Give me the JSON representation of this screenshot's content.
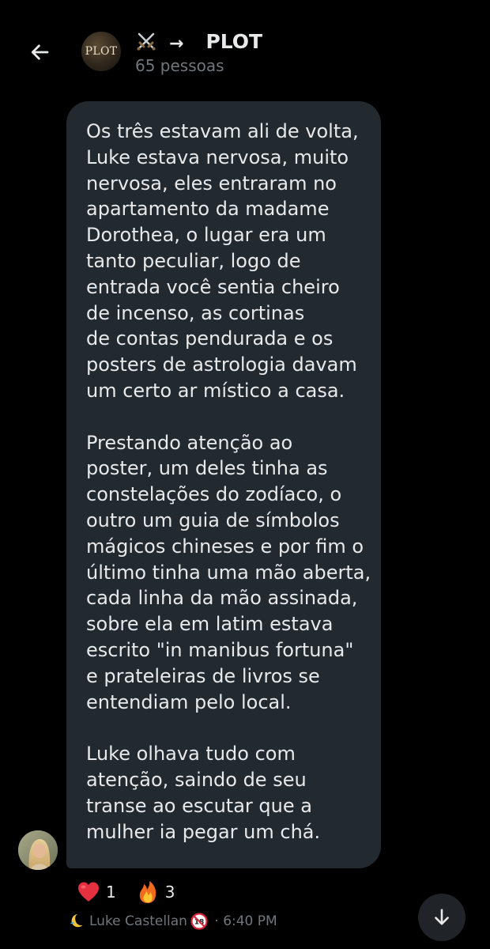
{
  "header": {
    "back_icon": "arrow-left-icon",
    "avatar_text": "PLOT",
    "title_emoji": "crossed-swords-icon",
    "title_arrow": "→",
    "title_text": "PLOT",
    "subtitle": "65 pessoas"
  },
  "message": {
    "paragraphs": [
      {
        "lines": [
          "Os três estavam ali de volta,",
          "Luke estava nervosa, muito",
          "nervosa, eles entraram no",
          "apartamento da madame",
          "Dorothea, o lugar era um",
          "tanto peculiar, logo de",
          "entrada você sentia cheiro",
          "de incenso, as cortinas",
          "de contas pendurada e os",
          "posters de astrologia davam",
          "um certo ar místico a casa."
        ]
      },
      {
        "lines": [
          "Prestando atenção ao",
          "poster, um deles tinha as",
          "constelações do zodíaco, o",
          "outro um guia de símbolos",
          "mágicos chineses e por fim o",
          "último tinha uma mão aberta,",
          "cada linha da mão assinada,",
          "sobre ela em latim estava",
          "escrito \"in manibus fortuna\"",
          "e prateleiras de livros se",
          "entendiam pelo local."
        ]
      },
      {
        "lines": [
          "Luke olhava tudo com",
          "atenção, saindo de seu",
          "transe ao escutar que a",
          "mulher ia pegar um chá."
        ]
      }
    ],
    "bubble_color": "#22292f"
  },
  "reactions": [
    {
      "icon": "red-heart-icon",
      "count": "1"
    },
    {
      "icon": "fire-icon",
      "count": "3"
    }
  ],
  "meta": {
    "moon_icon": "crescent-moon-icon",
    "sender": "Luke Castellan",
    "badge_icon": "no-one-under-eighteen-icon",
    "separator": " · ",
    "time": "6:40 PM"
  },
  "scroll_icon": "arrow-down-icon",
  "colors": {
    "background": "#000000",
    "text_primary": "#e7e9ea",
    "text_secondary": "#71767b"
  }
}
